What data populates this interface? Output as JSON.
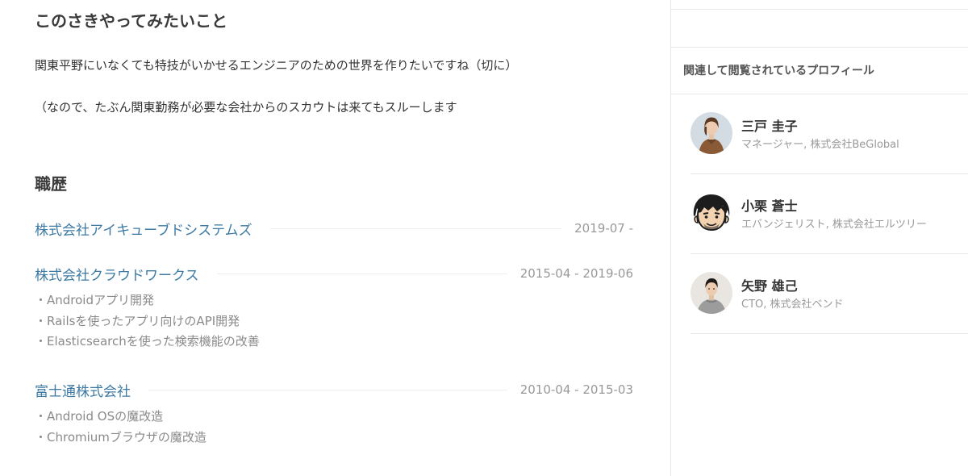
{
  "wish": {
    "heading": "このさきやってみたいこと",
    "line1": "関東平野にいなくても特技がいかせるエンジニアのための世界を作りたいですね（切に）",
    "line2": "（なので、たぶん関東勤務が必要な会社からのスカウトは来てもスルーします"
  },
  "career": {
    "heading": "職歴",
    "jobs": [
      {
        "company": "株式会社アイキューブドシステムズ",
        "period": "2019-07 -",
        "items": []
      },
      {
        "company": "株式会社クラウドワークス",
        "period": "2015-04 - 2019-06",
        "items": [
          "・Androidアプリ開発",
          "・Railsを使ったアプリ向けのAPI開発",
          "・Elasticsearchを使った検索機能の改善"
        ]
      },
      {
        "company": "富士通株式会社",
        "period": "2010-04 - 2015-03",
        "items": [
          "・Android OSの魔改造",
          "・Chromiumブラウザの魔改造"
        ]
      }
    ]
  },
  "sidebar": {
    "title": "関連して閲覧されているプロフィール",
    "profiles": [
      {
        "name": "三戸 圭子",
        "role": "マネージャー, 株式会社BeGlobal",
        "avatar_icon": "person-photo-icon"
      },
      {
        "name": "小栗 蒼士",
        "role": "エバンジェリスト, 株式会社エルツリー",
        "avatar_icon": "cartoon-face-icon"
      },
      {
        "name": "矢野 雄己",
        "role": "CTO, 株式会社ベンド",
        "avatar_icon": "person-photo-icon"
      }
    ]
  },
  "colors": {
    "link": "#3c7aa3",
    "muted": "#999999",
    "divider": "#e6e6e6"
  }
}
